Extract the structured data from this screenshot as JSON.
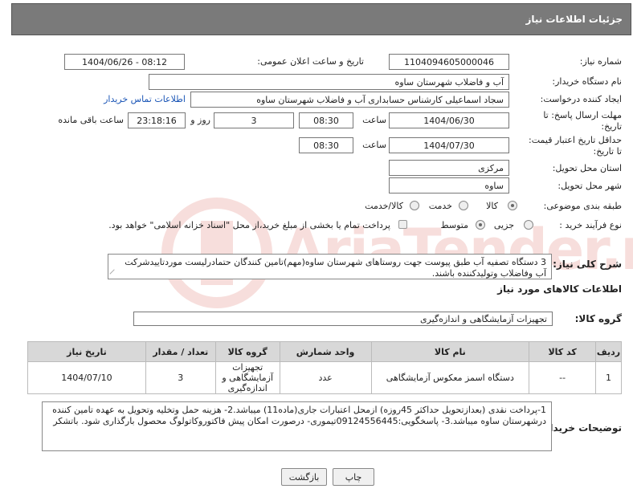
{
  "title": "جزئیات اطلاعات نیاز",
  "watermark": "AriaTender.neT",
  "fields": {
    "need_number": {
      "label": "شماره نیاز:",
      "value": "1104094605000046"
    },
    "announce_datetime": {
      "label": "تاریخ و ساعت اعلان عمومی:",
      "value": "1404/06/26 - 08:12"
    },
    "buyer_org": {
      "label": "نام دستگاه خریدار:",
      "value": "آب و فاضلاب شهرستان ساوه"
    },
    "creator": {
      "label": "ایجاد کننده درخواست:",
      "value": "سجاد اسماعیلی کارشناس حسابداری آب و فاضلاب شهرستان ساوه",
      "contact_link": "اطلاعات تماس خریدار"
    },
    "send_deadline": {
      "label_line1": "مهلت ارسال پاسخ: تا",
      "label_line2": "تاریخ:",
      "date": "1404/06/30",
      "time_label": "ساعت",
      "time": "08:30",
      "days": "3",
      "days_label": "روز و",
      "remaining": "23:18:16",
      "remaining_label": "ساعت باقی مانده"
    },
    "price_validity": {
      "label_line1": "حداقل تاریخ اعتبار قیمت:",
      "label_line2": "تا تاریخ:",
      "date": "1404/07/30",
      "time_label": "ساعت",
      "time": "08:30"
    },
    "delivery_province": {
      "label": "استان محل تحویل:",
      "value": "مرکزی"
    },
    "delivery_city": {
      "label": "شهر محل تحویل:",
      "value": "ساوه"
    },
    "category": {
      "label": "طبقه بندی موضوعی:",
      "options": [
        "کالا",
        "خدمت",
        "کالا/خدمت"
      ],
      "selected": "کالا"
    },
    "process_type": {
      "label": "نوع فرآیند خرید :",
      "options": [
        "جزیی",
        "متوسط"
      ],
      "selected": "متوسط",
      "note": "پرداخت تمام یا بخشی از مبلغ خرید،از محل \"اسناد خزانه اسلامی\" خواهد بود."
    }
  },
  "summary": {
    "label": "شرح کلی نیاز:",
    "text": "3 دستگاه تصفیه آب طبق پیوست جهت روستاهای شهرستان ساوه(مهم)تامین کنندگان حتمادرلیست موردتاییدشرکت آب وفاضلاب وتولیدکننده باشند."
  },
  "goods_section": {
    "heading": "اطلاعات کالاهای مورد نیاز",
    "group_label": "گروه کالا:",
    "group_value": "تجهیزات آزمایشگاهی و اندازه‌گیری"
  },
  "table": {
    "headers": [
      "ردیف",
      "کد کالا",
      "نام کالا",
      "واحد شمارش",
      "گروه کالا",
      "تعداد / مقدار",
      "تاریخ نیاز"
    ],
    "rows": [
      {
        "row": "1",
        "code": "--",
        "name": "دستگاه اسمز معکوس آزمایشگاهی",
        "unit": "عدد",
        "group": "تجهیزات آزمایشگاهی و اندازه‌گیری",
        "qty": "3",
        "date": "1404/07/10"
      }
    ]
  },
  "notes": {
    "label": "توضیحات خریدار:",
    "text": "1-پرداخت  نقدی (بعدازتحویل حداکثر 45روزه) ازمحل اعتبارات جاری(ماده11) میباشد.2- هزینه حمل وتخلیه وتحویل به عهده تامین کننده درشهرستان ساوه میباشد.3- پاسخگویی:09124556445تیموری- درصورت امکان پیش فاکتوروکاتولوگ محصول بارگذاری شود. باتشکر"
  },
  "buttons": {
    "print": "چاپ",
    "back": "بازگشت"
  }
}
